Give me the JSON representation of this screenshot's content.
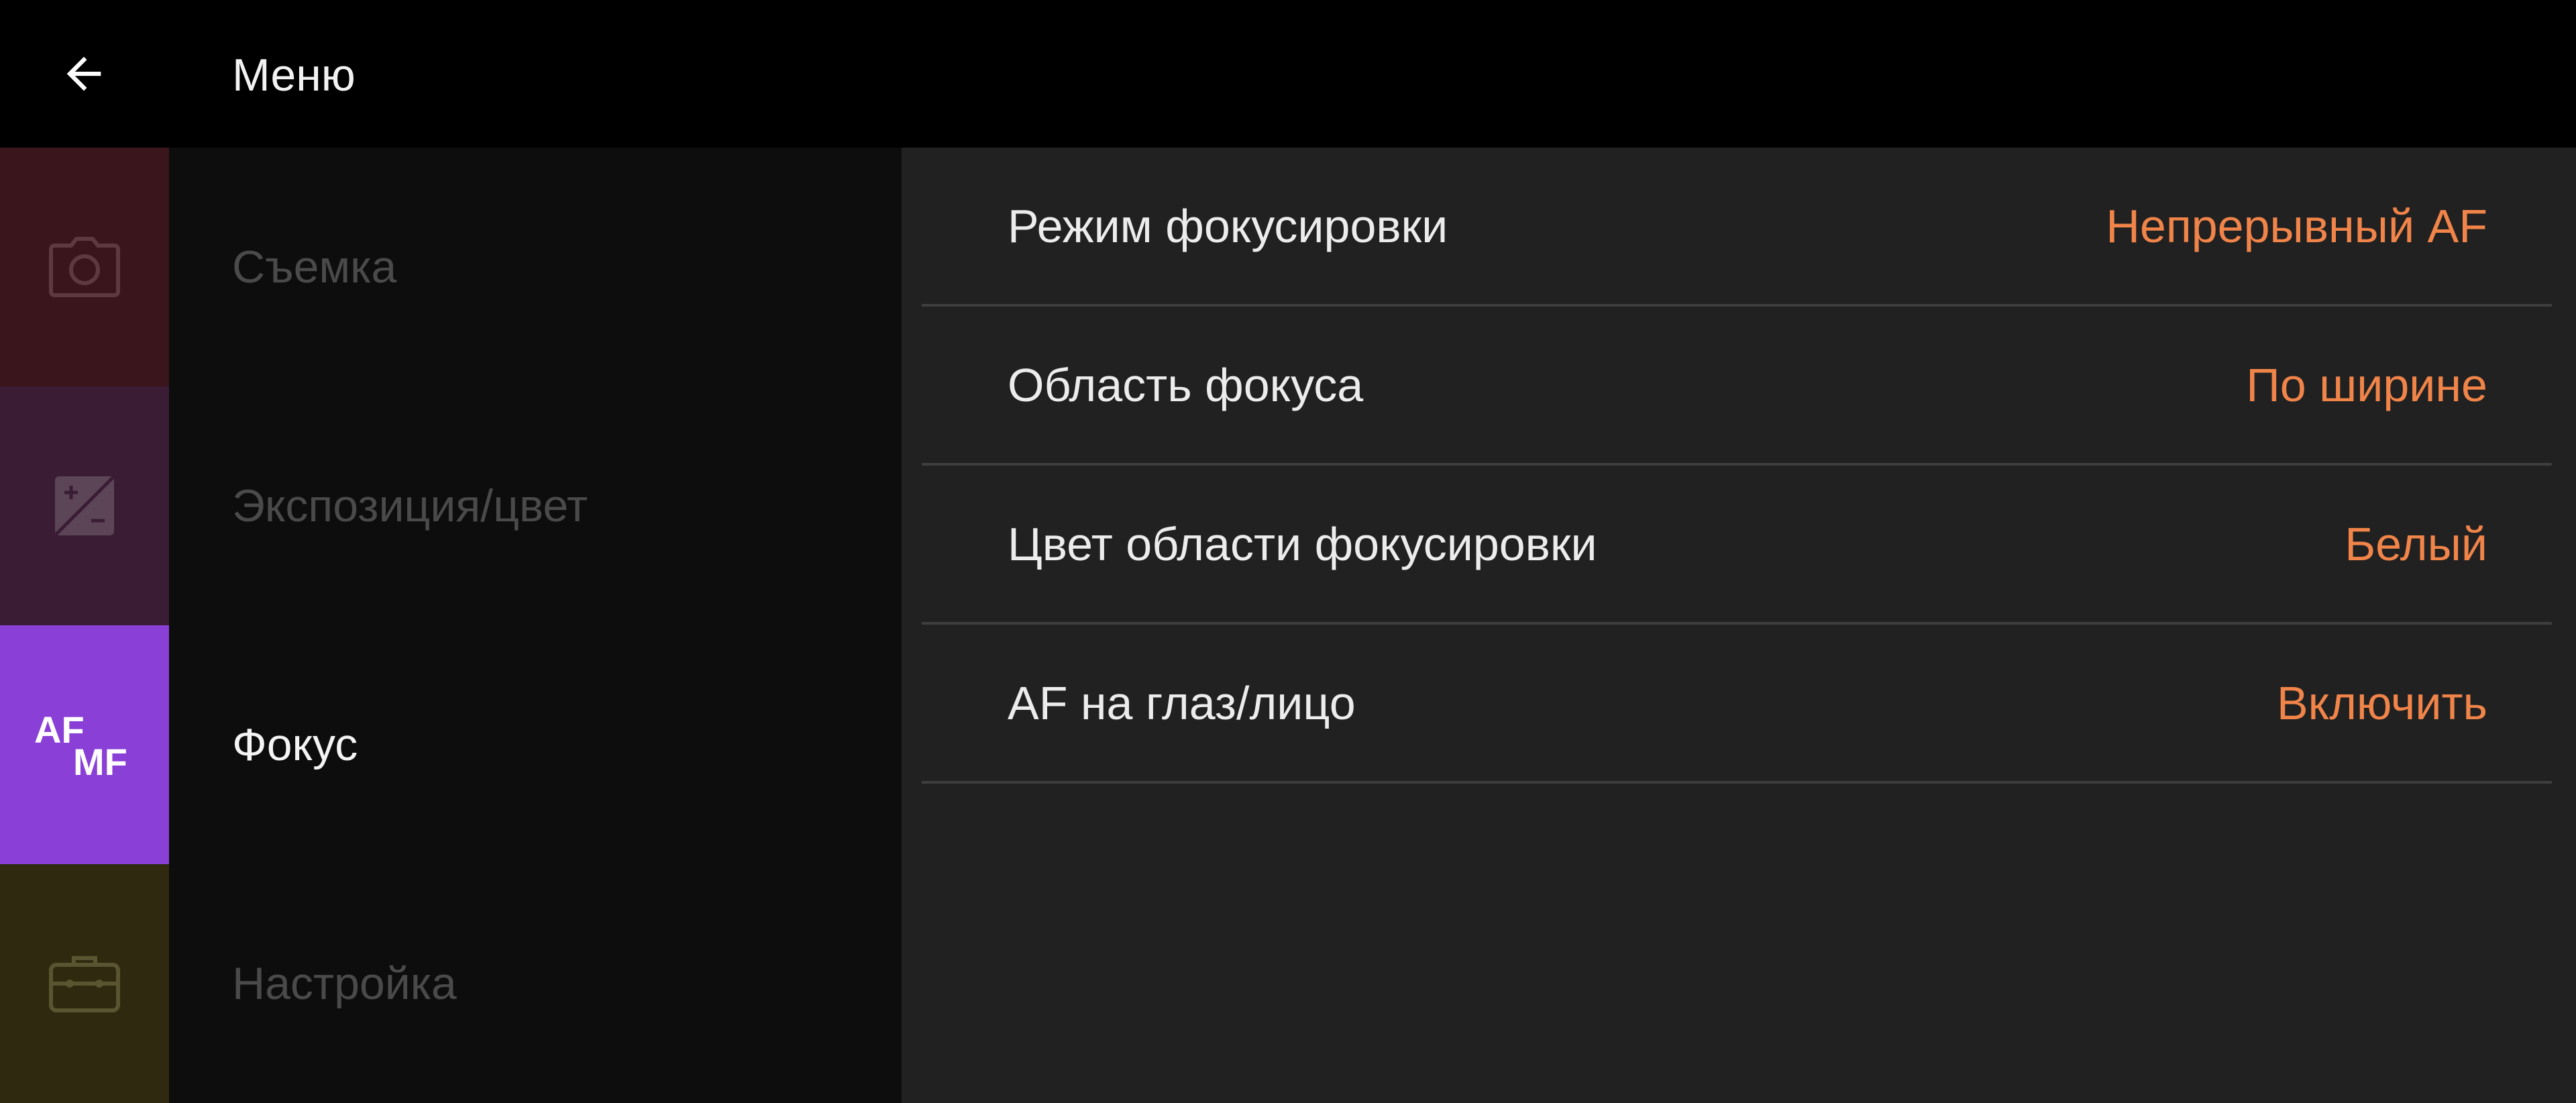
{
  "header": {
    "title": "Меню",
    "back_icon": "arrow-left-icon"
  },
  "sidebar": {
    "items": [
      {
        "label": "Съемка",
        "icon": "camera-icon",
        "color": "#3a151b",
        "active": false
      },
      {
        "label": "Экспозиция/цвет",
        "icon": "exposure-compensation-icon",
        "color": "#3a1d34",
        "active": false
      },
      {
        "label": "Фокус",
        "icon": "af-mf-icon",
        "icon_text": {
          "top": "AF",
          "bottom": "MF"
        },
        "color": "#8a3fd6",
        "active": true
      },
      {
        "label": "Настройка",
        "icon": "toolbox-icon",
        "color": "#2f2a0f",
        "active": false
      }
    ]
  },
  "settings": {
    "rows": [
      {
        "label": "Режим фокусировки",
        "value": "Непрерывный AF"
      },
      {
        "label": "Область фокуса",
        "value": "По ширине"
      },
      {
        "label": "Цвет области фокусировки",
        "value": "Белый"
      },
      {
        "label": "AF на глаз/лицо",
        "value": "Включить"
      }
    ]
  },
  "colors": {
    "accent_value": "#f08449",
    "panel_bg": "#212121",
    "rail_bg": "#0d0d0d",
    "divider": "#3e3e3e"
  }
}
